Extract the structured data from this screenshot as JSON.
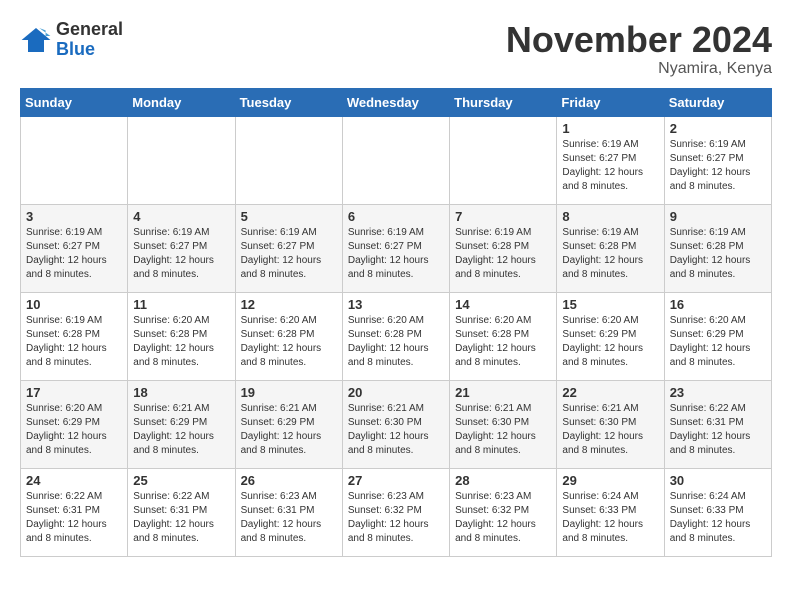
{
  "logo": {
    "general": "General",
    "blue": "Blue"
  },
  "title": "November 2024",
  "location": "Nyamira, Kenya",
  "weekdays": [
    "Sunday",
    "Monday",
    "Tuesday",
    "Wednesday",
    "Thursday",
    "Friday",
    "Saturday"
  ],
  "weeks": [
    [
      {
        "day": "",
        "info": ""
      },
      {
        "day": "",
        "info": ""
      },
      {
        "day": "",
        "info": ""
      },
      {
        "day": "",
        "info": ""
      },
      {
        "day": "",
        "info": ""
      },
      {
        "day": "1",
        "info": "Sunrise: 6:19 AM\nSunset: 6:27 PM\nDaylight: 12 hours and 8 minutes."
      },
      {
        "day": "2",
        "info": "Sunrise: 6:19 AM\nSunset: 6:27 PM\nDaylight: 12 hours and 8 minutes."
      }
    ],
    [
      {
        "day": "3",
        "info": "Sunrise: 6:19 AM\nSunset: 6:27 PM\nDaylight: 12 hours and 8 minutes."
      },
      {
        "day": "4",
        "info": "Sunrise: 6:19 AM\nSunset: 6:27 PM\nDaylight: 12 hours and 8 minutes."
      },
      {
        "day": "5",
        "info": "Sunrise: 6:19 AM\nSunset: 6:27 PM\nDaylight: 12 hours and 8 minutes."
      },
      {
        "day": "6",
        "info": "Sunrise: 6:19 AM\nSunset: 6:27 PM\nDaylight: 12 hours and 8 minutes."
      },
      {
        "day": "7",
        "info": "Sunrise: 6:19 AM\nSunset: 6:28 PM\nDaylight: 12 hours and 8 minutes."
      },
      {
        "day": "8",
        "info": "Sunrise: 6:19 AM\nSunset: 6:28 PM\nDaylight: 12 hours and 8 minutes."
      },
      {
        "day": "9",
        "info": "Sunrise: 6:19 AM\nSunset: 6:28 PM\nDaylight: 12 hours and 8 minutes."
      }
    ],
    [
      {
        "day": "10",
        "info": "Sunrise: 6:19 AM\nSunset: 6:28 PM\nDaylight: 12 hours and 8 minutes."
      },
      {
        "day": "11",
        "info": "Sunrise: 6:20 AM\nSunset: 6:28 PM\nDaylight: 12 hours and 8 minutes."
      },
      {
        "day": "12",
        "info": "Sunrise: 6:20 AM\nSunset: 6:28 PM\nDaylight: 12 hours and 8 minutes."
      },
      {
        "day": "13",
        "info": "Sunrise: 6:20 AM\nSunset: 6:28 PM\nDaylight: 12 hours and 8 minutes."
      },
      {
        "day": "14",
        "info": "Sunrise: 6:20 AM\nSunset: 6:28 PM\nDaylight: 12 hours and 8 minutes."
      },
      {
        "day": "15",
        "info": "Sunrise: 6:20 AM\nSunset: 6:29 PM\nDaylight: 12 hours and 8 minutes."
      },
      {
        "day": "16",
        "info": "Sunrise: 6:20 AM\nSunset: 6:29 PM\nDaylight: 12 hours and 8 minutes."
      }
    ],
    [
      {
        "day": "17",
        "info": "Sunrise: 6:20 AM\nSunset: 6:29 PM\nDaylight: 12 hours and 8 minutes."
      },
      {
        "day": "18",
        "info": "Sunrise: 6:21 AM\nSunset: 6:29 PM\nDaylight: 12 hours and 8 minutes."
      },
      {
        "day": "19",
        "info": "Sunrise: 6:21 AM\nSunset: 6:29 PM\nDaylight: 12 hours and 8 minutes."
      },
      {
        "day": "20",
        "info": "Sunrise: 6:21 AM\nSunset: 6:30 PM\nDaylight: 12 hours and 8 minutes."
      },
      {
        "day": "21",
        "info": "Sunrise: 6:21 AM\nSunset: 6:30 PM\nDaylight: 12 hours and 8 minutes."
      },
      {
        "day": "22",
        "info": "Sunrise: 6:21 AM\nSunset: 6:30 PM\nDaylight: 12 hours and 8 minutes."
      },
      {
        "day": "23",
        "info": "Sunrise: 6:22 AM\nSunset: 6:31 PM\nDaylight: 12 hours and 8 minutes."
      }
    ],
    [
      {
        "day": "24",
        "info": "Sunrise: 6:22 AM\nSunset: 6:31 PM\nDaylight: 12 hours and 8 minutes."
      },
      {
        "day": "25",
        "info": "Sunrise: 6:22 AM\nSunset: 6:31 PM\nDaylight: 12 hours and 8 minutes."
      },
      {
        "day": "26",
        "info": "Sunrise: 6:23 AM\nSunset: 6:31 PM\nDaylight: 12 hours and 8 minutes."
      },
      {
        "day": "27",
        "info": "Sunrise: 6:23 AM\nSunset: 6:32 PM\nDaylight: 12 hours and 8 minutes."
      },
      {
        "day": "28",
        "info": "Sunrise: 6:23 AM\nSunset: 6:32 PM\nDaylight: 12 hours and 8 minutes."
      },
      {
        "day": "29",
        "info": "Sunrise: 6:24 AM\nSunset: 6:33 PM\nDaylight: 12 hours and 8 minutes."
      },
      {
        "day": "30",
        "info": "Sunrise: 6:24 AM\nSunset: 6:33 PM\nDaylight: 12 hours and 8 minutes."
      }
    ]
  ]
}
